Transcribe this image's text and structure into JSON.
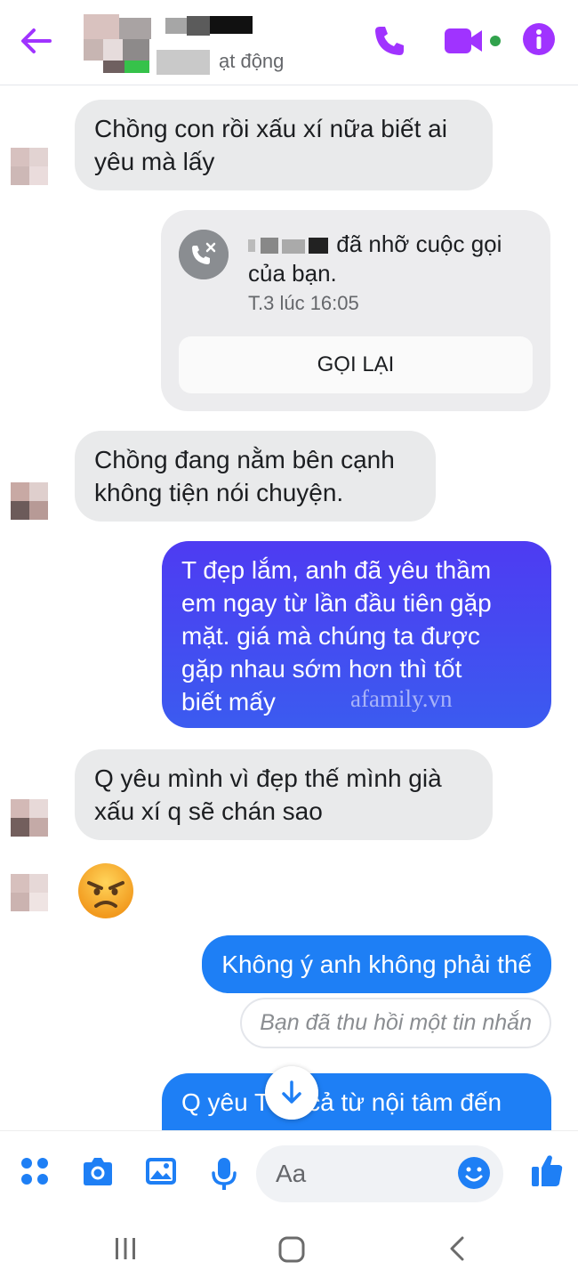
{
  "header": {
    "status_text": "ạt động",
    "icons": {
      "back": "back-arrow-icon",
      "phone": "phone-icon",
      "video": "video-camera-icon",
      "info": "info-icon"
    },
    "accent_color": "#a033ff"
  },
  "messages": {
    "m1": {
      "lines": [
        "Chồng con rồi xấu xí nữa biết ai",
        "yêu mà lấy"
      ]
    },
    "missed_call": {
      "text_after_name": "đã nhỡ cuộc gọi",
      "text_line2": "của bạn.",
      "time": "T.3 lúc 16:05",
      "callback_label": "GỌI LẠI"
    },
    "m2": {
      "lines": [
        "Chồng đang nằm bên cạnh",
        "không tiện nói chuyện."
      ]
    },
    "m3": {
      "lines": [
        "T đẹp lắm, anh đã yêu thầm",
        "em ngay từ lần đầu tiên gặp",
        "mặt. giá mà chúng ta được",
        "gặp nhau sớm hơn thì tốt",
        "biết mấy"
      ]
    },
    "watermark": "afamily.vn",
    "m4": {
      "lines": [
        "Q yêu mình vì đẹp thế mình già",
        "xấu xí q sẽ chán sao"
      ]
    },
    "emoji": "angry-face",
    "m5": {
      "text": "Không ý anh không phải thế"
    },
    "unsent": {
      "text": "Bạn đã thu hồi một tin nhắn"
    },
    "m6": {
      "text_left": "Q yêu T",
      "text_right": "cả từ nội tâm đến"
    }
  },
  "composer": {
    "placeholder": "Aa",
    "icons": [
      "apps-icon",
      "camera-icon",
      "image-icon",
      "microphone-icon",
      "emoji-icon",
      "thumbs-up-icon"
    ],
    "icon_color": "#1e7ff5"
  },
  "nav": {
    "icons": [
      "recents-icon",
      "home-icon",
      "back-icon"
    ]
  }
}
